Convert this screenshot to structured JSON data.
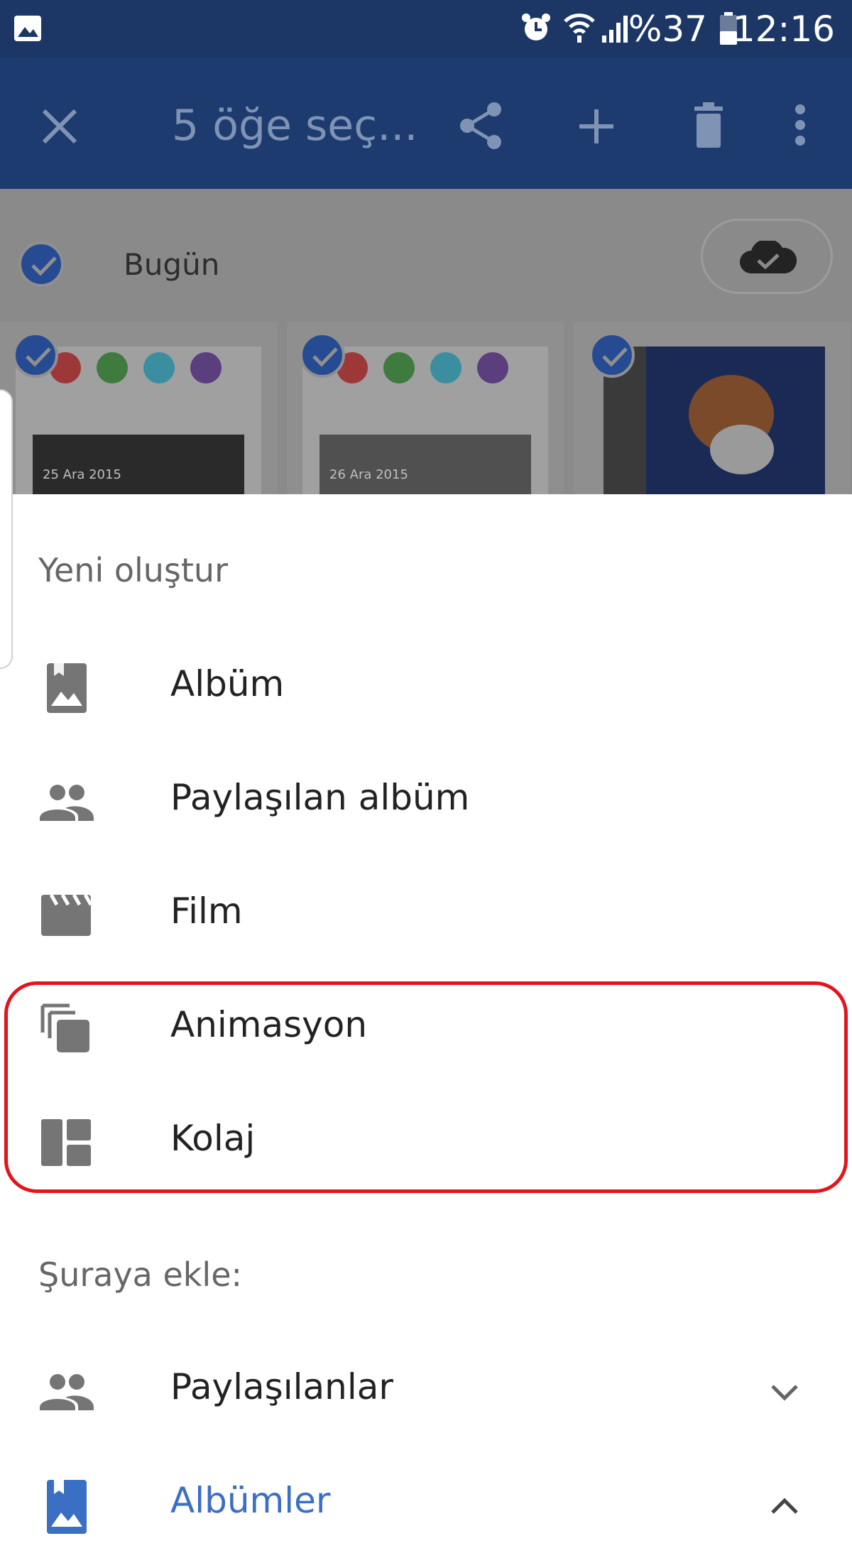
{
  "status_bar": {
    "battery_text": "%37",
    "time": "12:16",
    "icons": [
      "gallery-notification-icon",
      "alarm-icon",
      "wifi-icon",
      "signal-icon",
      "battery-icon"
    ]
  },
  "toolbar": {
    "title": "5 öğe seç...",
    "actions": [
      "close-icon",
      "share-icon",
      "add-icon",
      "delete-icon",
      "more-vert-icon"
    ]
  },
  "background": {
    "date_label": "Bugün",
    "thumbnails": [
      {
        "date": "25 Ara 2015"
      },
      {
        "date": "26 Ara 2015"
      },
      {
        "date": ""
      }
    ]
  },
  "sheet": {
    "create_header": "Yeni oluştur",
    "create_items": [
      {
        "label": "Albüm",
        "icon": "album-icon"
      },
      {
        "label": "Paylaşılan albüm",
        "icon": "people-icon"
      },
      {
        "label": "Film",
        "icon": "movie-icon"
      },
      {
        "label": "Animasyon",
        "icon": "animation-icon"
      },
      {
        "label": "Kolaj",
        "icon": "collage-icon"
      }
    ],
    "add_header": "Şuraya ekle:",
    "add_items": [
      {
        "label": "Paylaşılanlar",
        "icon": "people-icon",
        "state": "collapsed"
      },
      {
        "label": "Albümler",
        "icon": "album-bookmark-icon",
        "state": "expanded"
      }
    ],
    "highlight_color": "#e2141c",
    "accent_color": "#3b6fc4"
  }
}
